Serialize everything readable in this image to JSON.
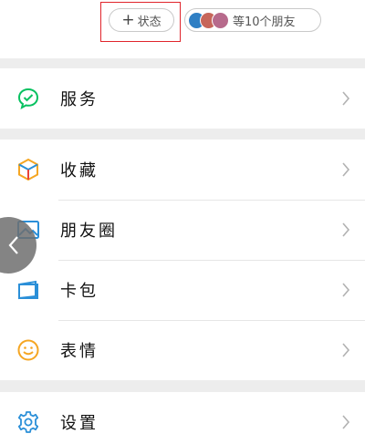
{
  "status": {
    "plus_symbol": "+",
    "label": "状态"
  },
  "friends": {
    "label": "等10个朋友",
    "avatar_colors": [
      "#2f7fc4",
      "#c7665a",
      "#b76a8c"
    ]
  },
  "menu": {
    "services": {
      "label": "服务",
      "icon": "wechat-pay-icon"
    },
    "favorites": {
      "label": "收藏",
      "icon": "cube-icon"
    },
    "moments": {
      "label": "朋友圈",
      "icon": "picture-icon"
    },
    "cards": {
      "label": "卡包",
      "icon": "wallet-icon"
    },
    "stickers": {
      "label": "表情",
      "icon": "smiley-icon"
    },
    "settings": {
      "label": "设置",
      "icon": "gear-icon"
    }
  },
  "colors": {
    "accent_green": "#07c160",
    "accent_blue": "#2a8fd8",
    "accent_yellow": "#f5a623",
    "highlight_red": "#e0242b"
  }
}
